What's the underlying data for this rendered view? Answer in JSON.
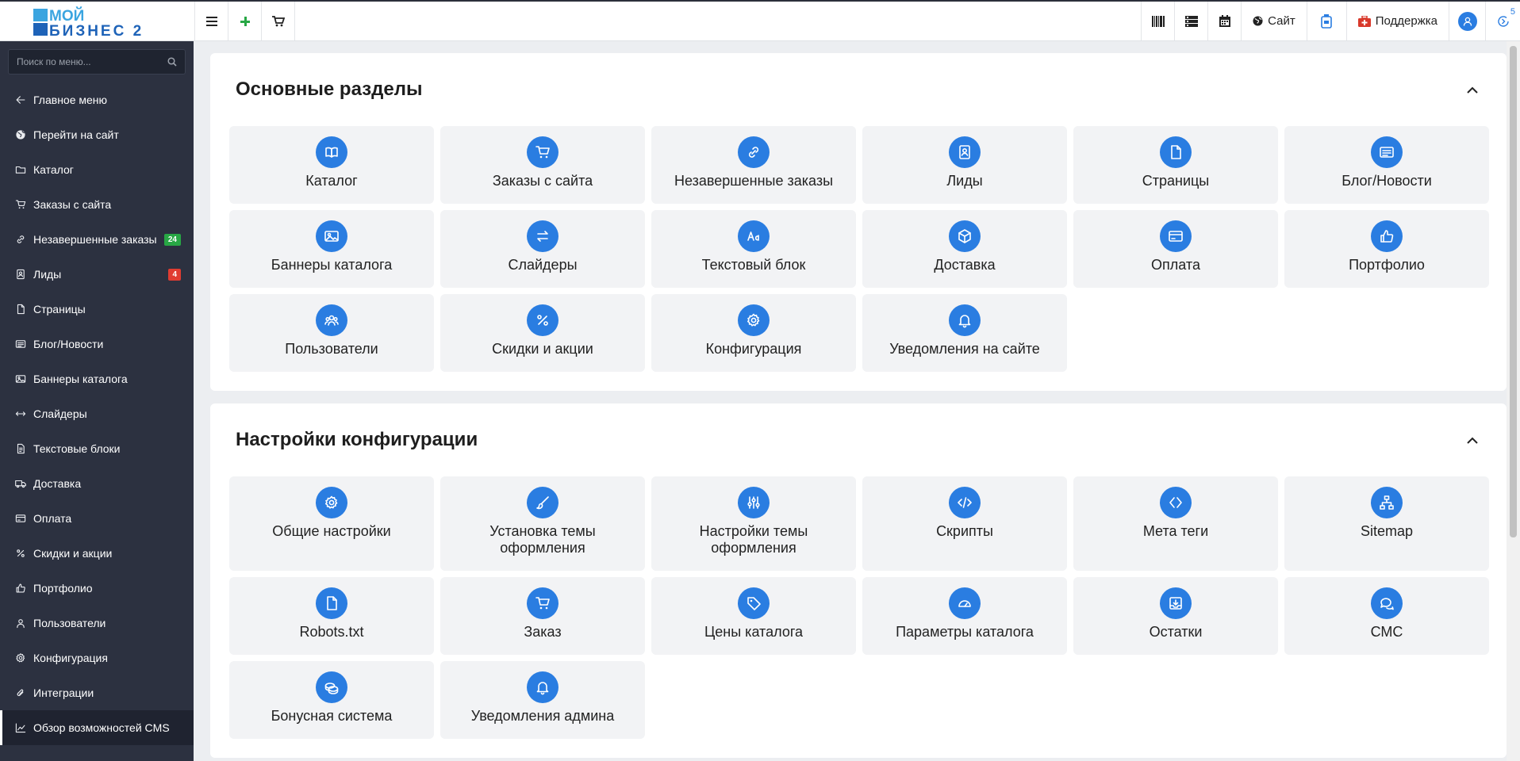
{
  "brand": {
    "logo_line1": "МОЙ",
    "logo_line2": "БИЗНЕС 2"
  },
  "topbar": {
    "site_label": "Сайт",
    "support_label": "Поддержка",
    "notifications_count": "5"
  },
  "sidebar": {
    "search_placeholder": "Поиск по меню...",
    "items": [
      {
        "label": "Главное меню",
        "icon": "arrow-left-icon"
      },
      {
        "label": "Перейти на сайт",
        "icon": "globe-icon"
      },
      {
        "label": "Каталог",
        "icon": "folder-icon"
      },
      {
        "label": "Заказы с сайта",
        "icon": "cart-icon"
      },
      {
        "label": "Незавершенные заказы",
        "icon": "link-icon",
        "badge": "24",
        "badge_color": "#28a745"
      },
      {
        "label": "Лиды",
        "icon": "contact-icon",
        "badge": "4",
        "badge_color": "#e03c31"
      },
      {
        "label": "Страницы",
        "icon": "file-icon"
      },
      {
        "label": "Блог/Новости",
        "icon": "newspaper-icon"
      },
      {
        "label": "Баннеры каталога",
        "icon": "image-icon"
      },
      {
        "label": "Слайдеры",
        "icon": "arrows-h-icon"
      },
      {
        "label": "Текстовые блоки",
        "icon": "file-text-icon"
      },
      {
        "label": "Доставка",
        "icon": "truck-icon"
      },
      {
        "label": "Оплата",
        "icon": "credit-card-icon"
      },
      {
        "label": "Скидки и акции",
        "icon": "percent-icon"
      },
      {
        "label": "Портфолио",
        "icon": "thumbs-up-icon"
      },
      {
        "label": "Пользователи",
        "icon": "user-icon"
      },
      {
        "label": "Конфигурация",
        "icon": "gear-icon"
      },
      {
        "label": "Интеграции",
        "icon": "paperclip-icon"
      },
      {
        "label": "Обзор возможностей CMS",
        "icon": "chart-line-icon",
        "active": true
      }
    ]
  },
  "sections": [
    {
      "title": "Основные разделы",
      "tiles": [
        {
          "label": "Каталог",
          "icon": "book-icon"
        },
        {
          "label": "Заказы с сайта",
          "icon": "cart-icon"
        },
        {
          "label": "Незавершенные заказы",
          "icon": "link-icon"
        },
        {
          "label": "Лиды",
          "icon": "contact-icon"
        },
        {
          "label": "Страницы",
          "icon": "file-icon"
        },
        {
          "label": "Блог/Новости",
          "icon": "newspaper-icon"
        },
        {
          "label": "Баннеры каталога",
          "icon": "image-icon"
        },
        {
          "label": "Слайдеры",
          "icon": "arrows-icon"
        },
        {
          "label": "Текстовый блок",
          "icon": "text-icon"
        },
        {
          "label": "Доставка",
          "icon": "box-icon"
        },
        {
          "label": "Оплата",
          "icon": "credit-card-icon"
        },
        {
          "label": "Портфолио",
          "icon": "thumbs-up-icon"
        },
        {
          "label": "Пользователи",
          "icon": "users-icon"
        },
        {
          "label": "Скидки и акции",
          "icon": "percent-icon"
        },
        {
          "label": "Конфигурация",
          "icon": "gear-icon"
        },
        {
          "label": "Уведомления на сайте",
          "icon": "bell-icon"
        }
      ]
    },
    {
      "title": "Настройки конфигурации",
      "tiles": [
        {
          "label": "Общие настройки",
          "icon": "gear-icon"
        },
        {
          "label": "Установка темы оформления",
          "icon": "brush-icon"
        },
        {
          "label": "Настройки темы оформления",
          "icon": "sliders-icon"
        },
        {
          "label": "Скрипты",
          "icon": "code-icon"
        },
        {
          "label": "Мета теги",
          "icon": "brackets-icon"
        },
        {
          "label": "Sitemap",
          "icon": "sitemap-icon"
        },
        {
          "label": "Robots.txt",
          "icon": "file-icon"
        },
        {
          "label": "Заказ",
          "icon": "cart-icon"
        },
        {
          "label": "Цены каталога",
          "icon": "tag-icon"
        },
        {
          "label": "Параметры каталога",
          "icon": "gauge-icon"
        },
        {
          "label": "Остатки",
          "icon": "inbox-icon"
        },
        {
          "label": "СМС",
          "icon": "chat-icon"
        },
        {
          "label": "Бонусная система",
          "icon": "coins-icon"
        },
        {
          "label": "Уведомления админа",
          "icon": "bell-icon"
        }
      ]
    }
  ],
  "colors": {
    "accent": "#2a7de1",
    "sidebar_bg": "#2c3140",
    "tile_bg": "#f2f3f5"
  }
}
